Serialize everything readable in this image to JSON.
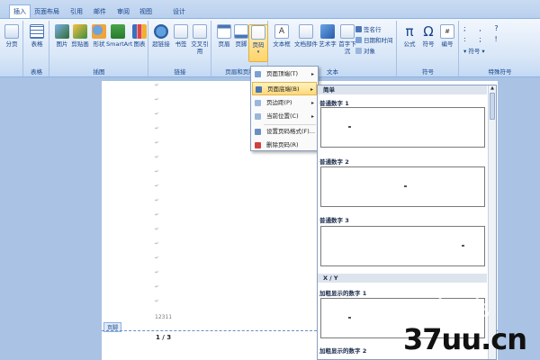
{
  "tabs": [
    "插入",
    "页面布局",
    "引用",
    "邮件",
    "审阅",
    "视图",
    "设计"
  ],
  "ribbon": {
    "pages_group": {
      "label": "",
      "buttons": [
        "分页"
      ]
    },
    "table_group": {
      "label": "表格",
      "buttons": [
        "表格"
      ]
    },
    "illustrations_group": {
      "label": "插图",
      "buttons": [
        "图片",
        "剪贴画",
        "形状",
        "SmartArt",
        "图表"
      ]
    },
    "links_group": {
      "label": "链接",
      "buttons": [
        "超链接",
        "书签",
        "交叉引用"
      ]
    },
    "header_footer_group": {
      "label": "页眉和页脚",
      "buttons": [
        "页眉",
        "页脚",
        "页码"
      ]
    },
    "text_group": {
      "label": "文本",
      "buttons": [
        "文本框",
        "文档部件",
        "艺术字",
        "首字下沉"
      ],
      "small_buttons": [
        "签名行",
        "日期和时间",
        "对象"
      ]
    },
    "symbols_group": {
      "label": "符号",
      "buttons": [
        "公式",
        "符号",
        "编号"
      ]
    },
    "special_group": {
      "label": "特殊符号",
      "buttons": [
        "符号"
      ]
    }
  },
  "menu": {
    "items": [
      {
        "label": "页面顶端(T)",
        "has_arrow": true
      },
      {
        "label": "页面底端(B)",
        "has_arrow": true,
        "selected": true
      },
      {
        "label": "页边距(P)",
        "has_arrow": true
      },
      {
        "label": "当前位置(C)",
        "has_arrow": true
      },
      {
        "label": "设置页码格式(F)...",
        "has_arrow": false
      },
      {
        "label": "删除页码(R)",
        "has_arrow": false
      }
    ]
  },
  "gallery": {
    "header": "简单",
    "items": [
      {
        "label": "普通数字 1"
      },
      {
        "label": "普通数字 2"
      },
      {
        "label": "普通数字 3"
      }
    ],
    "section2": "X / Y",
    "items2": [
      {
        "label": "加粗显示的数字 1"
      },
      {
        "label": "加粗显示的数字 2"
      }
    ]
  },
  "document": {
    "footer_tag": "页脚",
    "footer_number": "12311",
    "footer_page": "1 / 3"
  },
  "watermark": {
    "logo": "十巴色",
    "site": "37uu.cn"
  },
  "colors": {
    "accent": "#15428b",
    "highlight": "#ffd36a",
    "ribbon_bg": "#d6e5f7"
  }
}
